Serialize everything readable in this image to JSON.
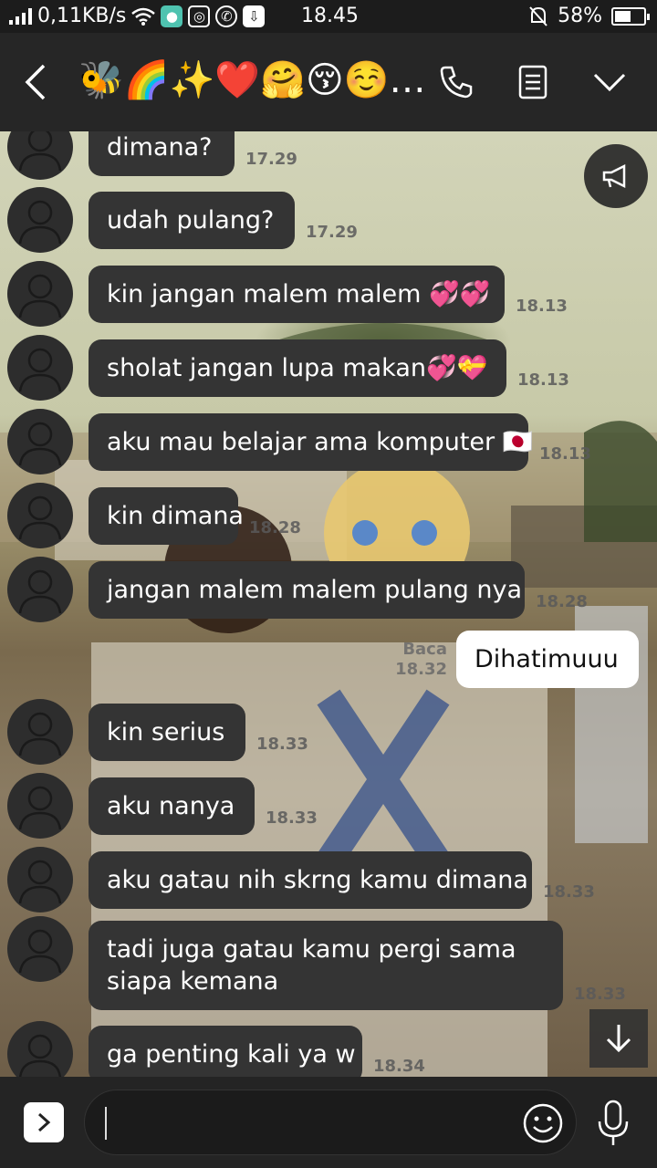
{
  "status_bar": {
    "speed": "0,11KB/s",
    "time": "18.45",
    "battery": "58%",
    "battery_level": 0.58
  },
  "header": {
    "title": "🐝🌈✨❤️🤗😚☺️…",
    "icons": [
      "back-icon",
      "call-icon",
      "notes-icon",
      "chevron-down-icon"
    ]
  },
  "messages": [
    {
      "side": "in",
      "text": "dimana?",
      "time": "17.29"
    },
    {
      "side": "in",
      "text": "udah pulang?",
      "time": "17.29"
    },
    {
      "side": "in",
      "text": "kin jangan malem malem 💞💞",
      "time": "18.13"
    },
    {
      "side": "in",
      "text": "sholat jangan lupa makan💞💝",
      "time": "18.13"
    },
    {
      "side": "in",
      "text": "aku mau belajar ama komputer 🇯🇵",
      "time": "18.13"
    },
    {
      "side": "in",
      "text": "kin dimana",
      "time": "18.28"
    },
    {
      "side": "in",
      "text": "jangan malem malem pulang nya",
      "time": "18.28"
    },
    {
      "side": "out",
      "text": "Dihatimuuu",
      "read": "Baca",
      "time": "18.32"
    },
    {
      "side": "in",
      "text": "kin serius",
      "time": "18.33"
    },
    {
      "side": "in",
      "text": "aku nanya",
      "time": "18.33"
    },
    {
      "side": "in",
      "text": "aku gatau nih skrng kamu dimana",
      "time": "18.33"
    },
    {
      "side": "in",
      "text": "tadi juga gatau kamu pergi sama siapa kemana",
      "time": "18.33"
    },
    {
      "side": "in",
      "text": "ga penting kali ya w",
      "time": "18.34"
    }
  ],
  "colors": {
    "bubble_in": "#343434",
    "bubble_out": "#ffffff",
    "header_bg": "#262626",
    "input_bg": "#242424"
  }
}
